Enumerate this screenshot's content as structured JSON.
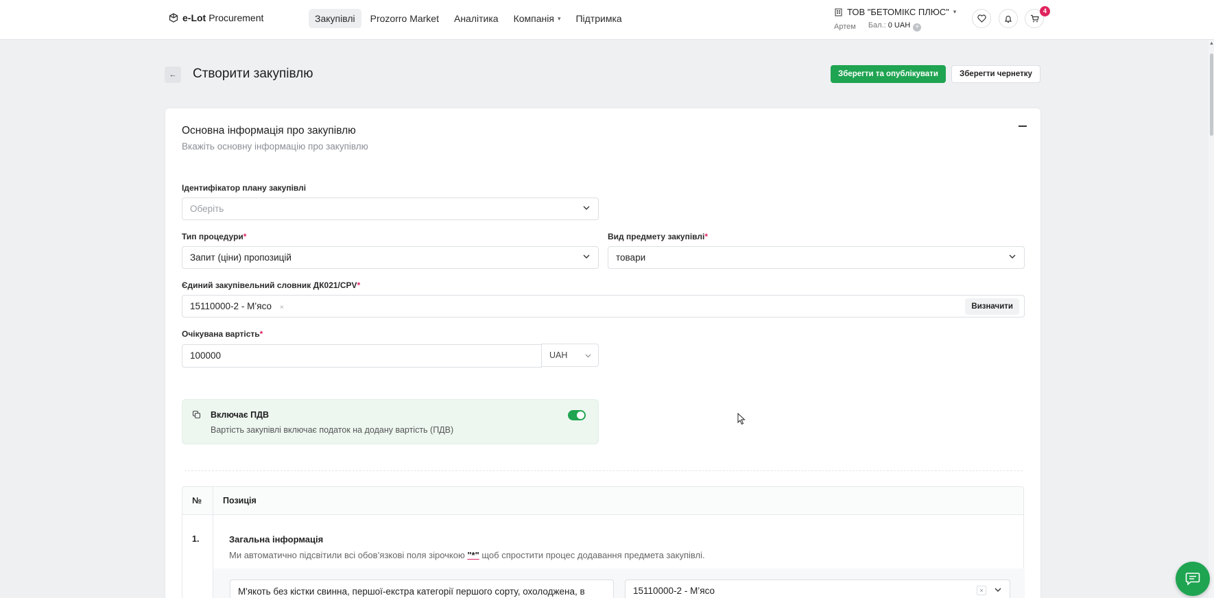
{
  "header": {
    "logo_bold": "e-Lot",
    "logo_rest": "Procurement",
    "nav": [
      {
        "label": "Закупівлі",
        "active": true
      },
      {
        "label": "Prozorro Market"
      },
      {
        "label": "Аналітика"
      },
      {
        "label": "Компанія",
        "dropdown": true
      },
      {
        "label": "Підтримка"
      }
    ],
    "company_name": "ТОВ \"БЕТОМІКС ПЛЮС\"",
    "user_name": "Артем",
    "balance_label": "Бал.:",
    "balance_value": "0 UAH",
    "cart_count": "4"
  },
  "page": {
    "title": "Створити закупівлю",
    "publish_label": "Зберегти та опублікувати",
    "draft_label": "Зберегти чернетку"
  },
  "section": {
    "title": "Основна інформація про закупівлю",
    "subtitle": "Вкажіть основну інформацію про закупівлю",
    "plan_label": "Ідентифікатор плану закупівлі",
    "plan_placeholder": "Оберіть",
    "procedure_label": "Тип процедури",
    "procedure_value": "Запит (ціни) пропозицій",
    "subject_label": "Вид предмету закупівлі",
    "subject_value": "товари",
    "cpv_label": "Єдиний закупівельний словник ДК021/CPV",
    "cpv_value": "15110000-2 - М’ясо",
    "cpv_button": "Визначити",
    "value_label": "Очікувана вартість",
    "value_amount": "100000",
    "currency": "UAH",
    "required_mark": "*"
  },
  "vat": {
    "title": "Включає ПДВ",
    "description": "Вартість закупівлі включає податок на додану вартість (ПДВ)",
    "enabled": true
  },
  "table": {
    "col_num": "№",
    "col_position": "Позиція",
    "rows": [
      {
        "num": "1.",
        "title": "Загальна інформація",
        "note_before": "Ми автоматично підсвітили всі обов’язкові поля зірочкою",
        "note_star": "\"*\"",
        "note_after": "щоб спростити процес додавання предмета закупівлі.",
        "item_name": "М'якоть без кістки свинна, першої-екстра категорії першого сорту, охолоджена, в",
        "item_cpv": "15110000-2 - М’ясо"
      }
    ]
  },
  "colors": {
    "primary_green": "#1fa451",
    "badge_red": "#e0245e",
    "background": "#eef0f2"
  }
}
